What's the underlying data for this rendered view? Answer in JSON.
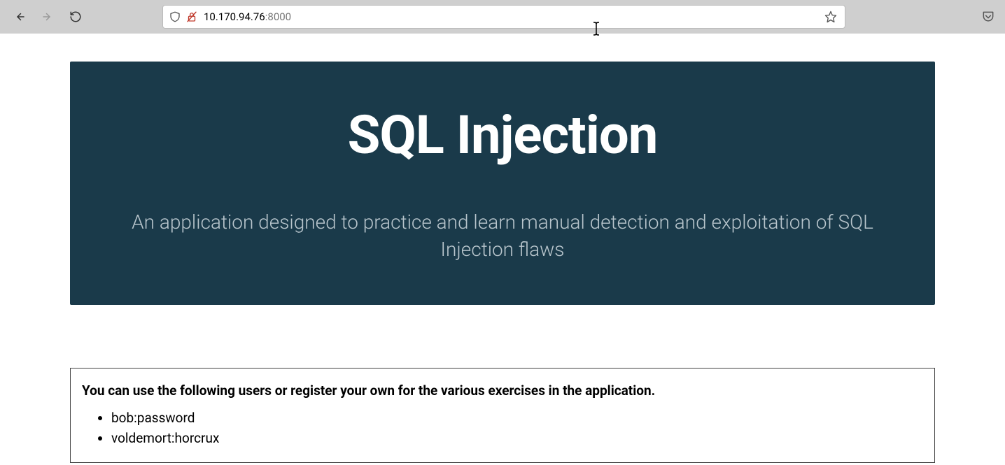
{
  "browser": {
    "url_host": "10.170.94.76",
    "url_port": ":8000"
  },
  "hero": {
    "title": "SQL Injection",
    "subtitle": "An application designed to practice and learn manual detection and exploitation of SQL Injection flaws"
  },
  "info": {
    "heading": "You can use the following users or register your own for the various exercises in the application.",
    "users": [
      "bob:password",
      "voldemort:horcrux"
    ]
  }
}
